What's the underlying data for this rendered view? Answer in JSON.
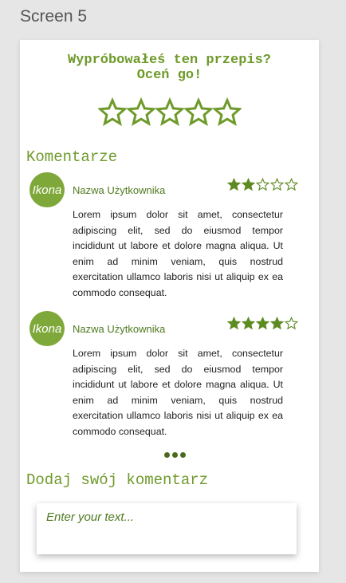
{
  "screen_label": "Screen 5",
  "rating_prompt": {
    "line1": "Wypróbowałeś ten przepis?",
    "line2": "Oceń go!",
    "rating": 0,
    "max": 5
  },
  "comments_section": {
    "title": "Komentarze",
    "items": [
      {
        "avatar_label": "Ikona",
        "username": "Nazwa Użytkownika",
        "rating": 2,
        "max": 5,
        "text": "Lorem ipsum dolor sit amet, consectetur adipiscing elit, sed do eiusmod tempor incididunt ut labore et dolore magna aliqua. Ut enim ad minim veniam, quis nostrud exercitation ullamco laboris nisi ut aliquip ex ea commodo consequat."
      },
      {
        "avatar_label": "Ikona",
        "username": "Nazwa Użytkownika",
        "rating": 4,
        "max": 5,
        "text": "Lorem ipsum dolor sit amet, consectetur adipiscing elit, sed do eiusmod tempor incididunt ut labore et dolore magna aliqua. Ut enim ad minim veniam, quis nostrud exercitation ullamco laboris nisi ut aliquip ex ea commodo consequat."
      }
    ],
    "more_icon": "more-dots-icon"
  },
  "add_comment": {
    "title": "Dodaj swój komentarz",
    "placeholder": "Enter your text..."
  },
  "colors": {
    "accent": "#6e9a2a",
    "avatar": "#7ea83a",
    "dark_green": "#4a6b1e"
  }
}
